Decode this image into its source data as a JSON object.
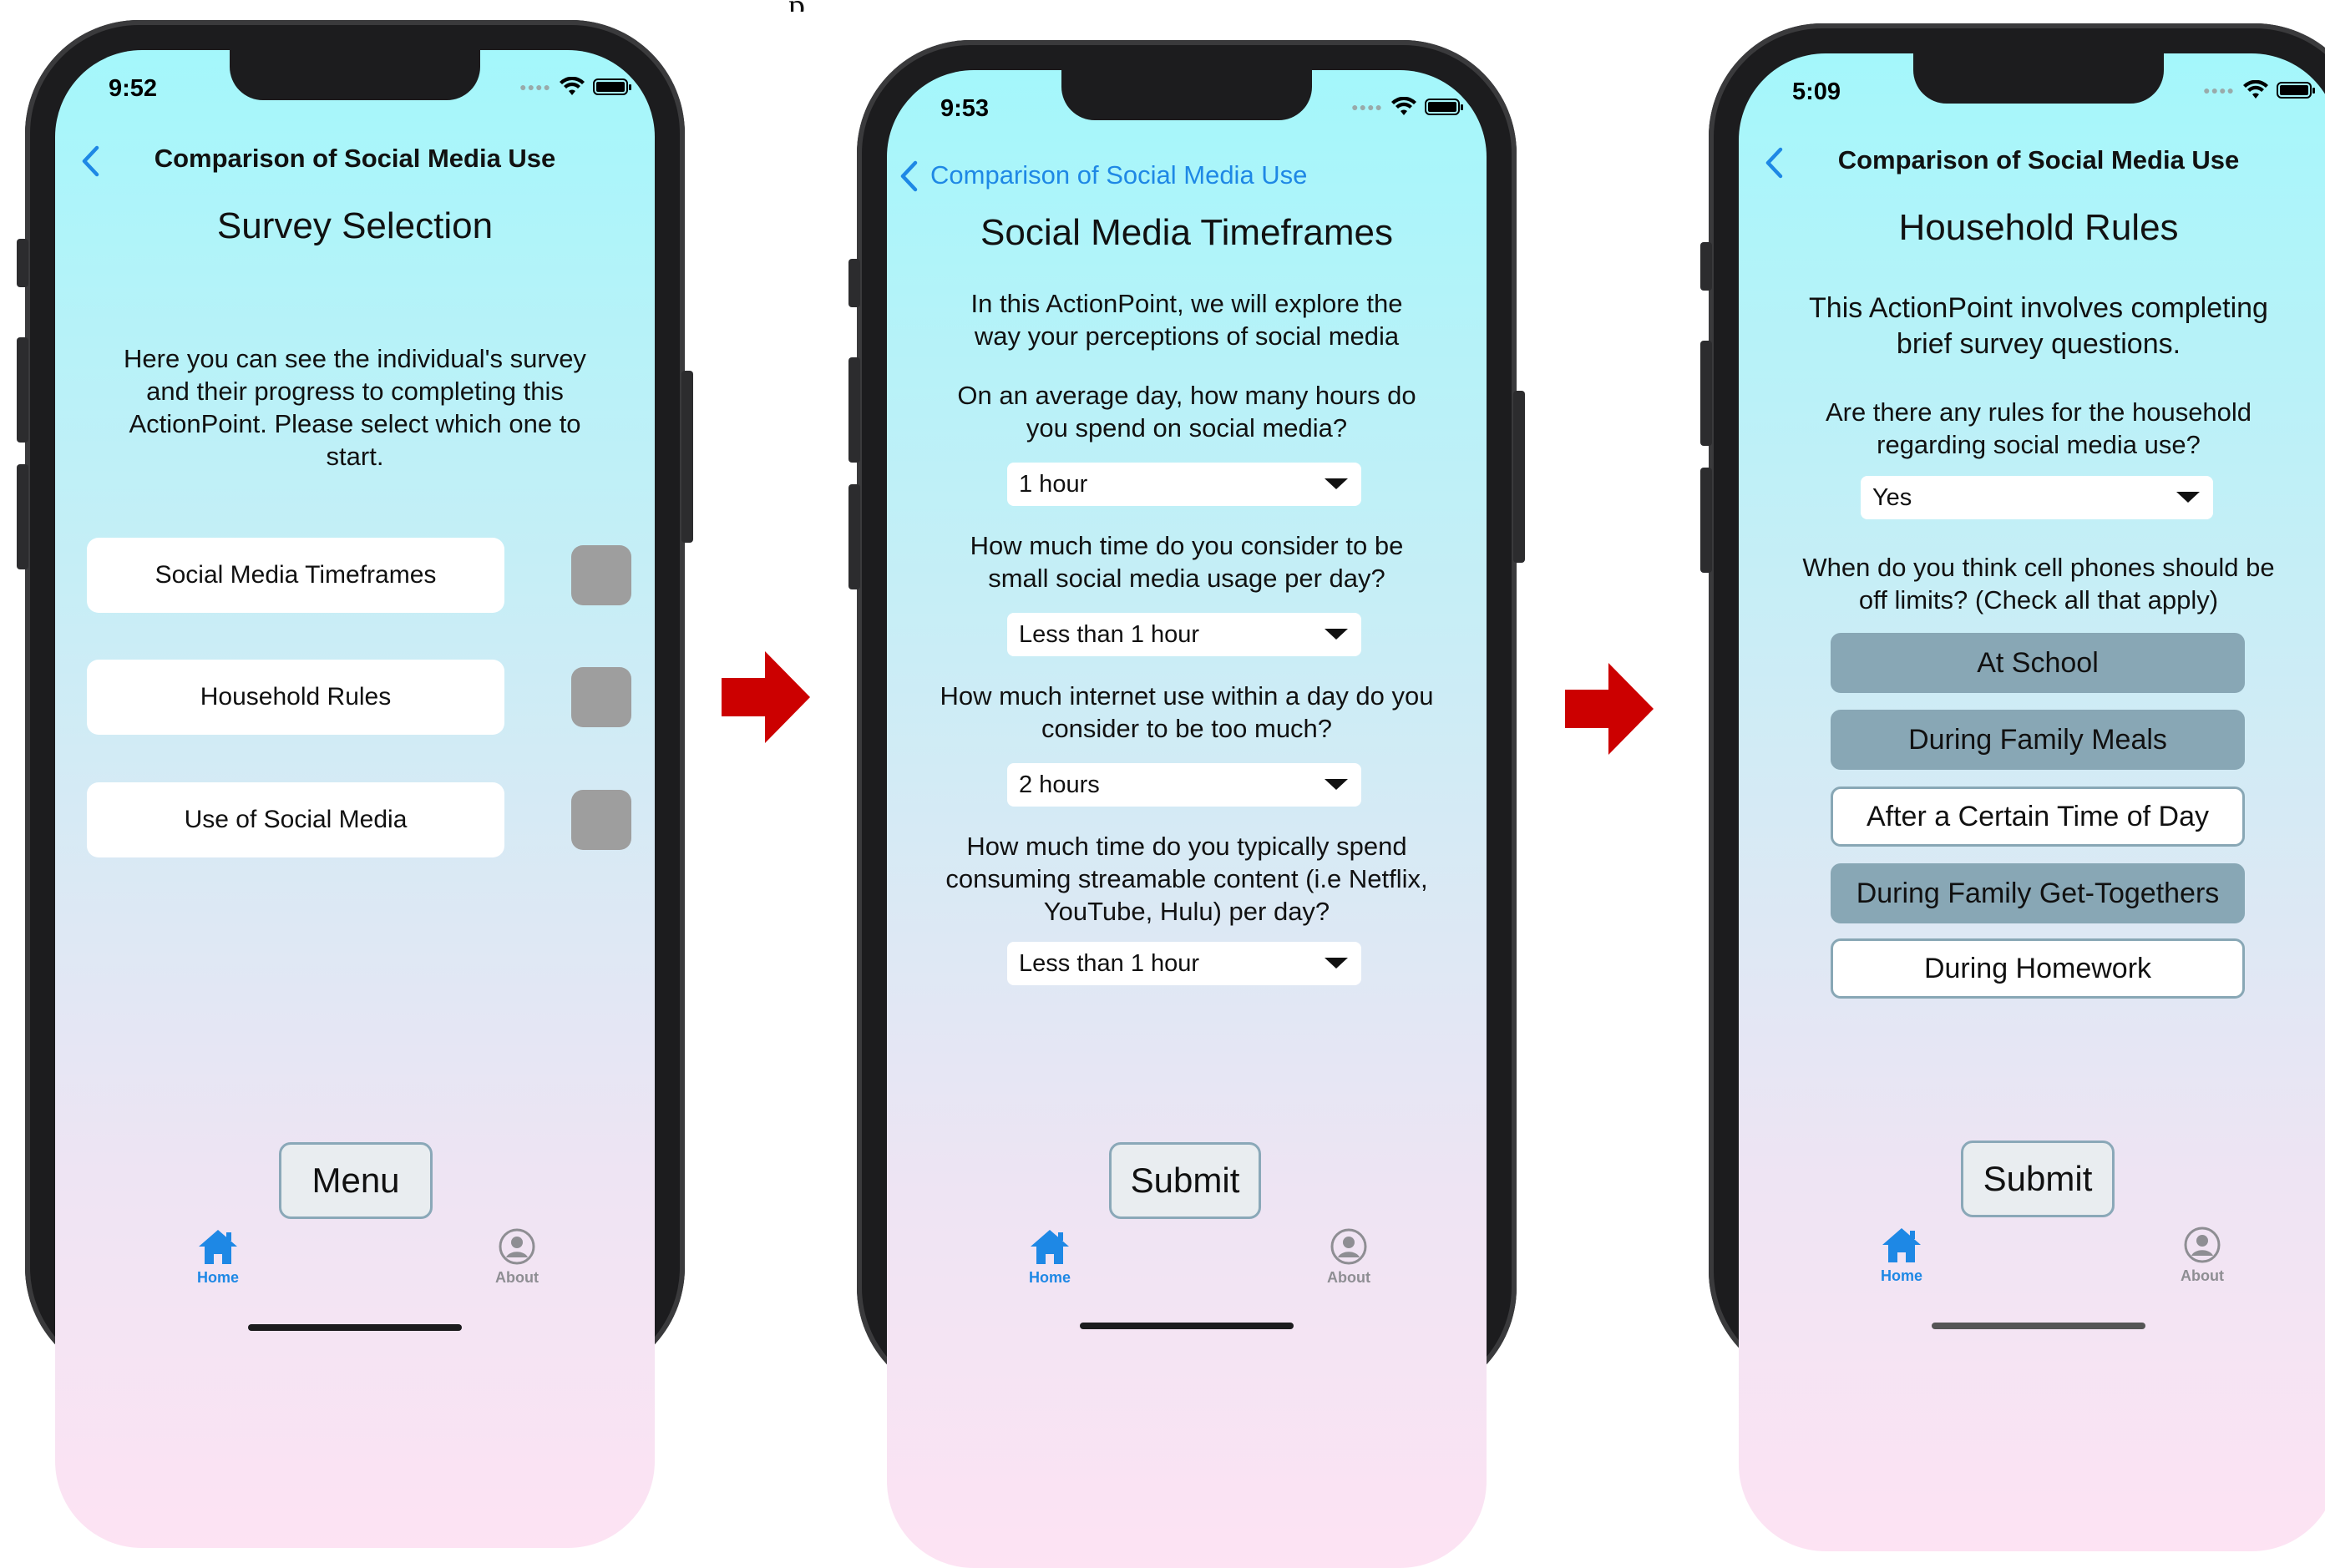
{
  "colors": {
    "accent": "#1e88e5",
    "arrow": "#cc0000",
    "selected_option": "#88a7b5",
    "status_square": "#9e9e9e"
  },
  "screen1": {
    "time": "9:52",
    "nav_title": "Comparison of Social Media Use",
    "heading": "Survey Selection",
    "description": "Here you can see the individual's survey and their progress to completing this ActionPoint. Please select which one to start.",
    "surveys": [
      {
        "label": "Social Media Timeframes"
      },
      {
        "label": "Household Rules"
      },
      {
        "label": "Use of Social Media"
      }
    ],
    "menu_button": "Menu",
    "tabs": {
      "home": "Home",
      "about": "About"
    }
  },
  "screen2": {
    "time": "9:53",
    "back_label": "Comparison of Social Media Use",
    "heading": "Social Media Timeframes",
    "intro": "In this ActionPoint, we will explore the way your perceptions of social media",
    "questions": [
      {
        "text": "On an average day, how many hours do you spend on social media?",
        "answer": "1 hour"
      },
      {
        "text": "How much time do you consider to be small social media usage per day?",
        "answer": "Less than 1 hour"
      },
      {
        "text": "How much internet use within a day do you consider to be too much?",
        "answer": "2 hours"
      },
      {
        "text": "How much time do you typically spend consuming streamable content (i.e Netflix, YouTube, Hulu) per day?",
        "answer": "Less than 1 hour"
      }
    ],
    "submit_button": "Submit",
    "tabs": {
      "home": "Home",
      "about": "About"
    }
  },
  "screen3": {
    "time": "5:09",
    "nav_title": "Comparison of Social Media Use",
    "heading": "Household Rules",
    "intro": "This ActionPoint involves completing brief survey questions.",
    "question1": "Are there any rules for the household regarding social media use?",
    "answer1": "Yes",
    "question2": "When do you think cell phones should be off limits? (Check all that apply)",
    "options": [
      {
        "label": "At School",
        "selected": true
      },
      {
        "label": "During Family Meals",
        "selected": true
      },
      {
        "label": "After a Certain Time of Day",
        "selected": false
      },
      {
        "label": "During Family Get-Togethers",
        "selected": true
      },
      {
        "label": "During Homework",
        "selected": false
      }
    ],
    "submit_button": "Submit",
    "tabs": {
      "home": "Home",
      "about": "About"
    }
  }
}
